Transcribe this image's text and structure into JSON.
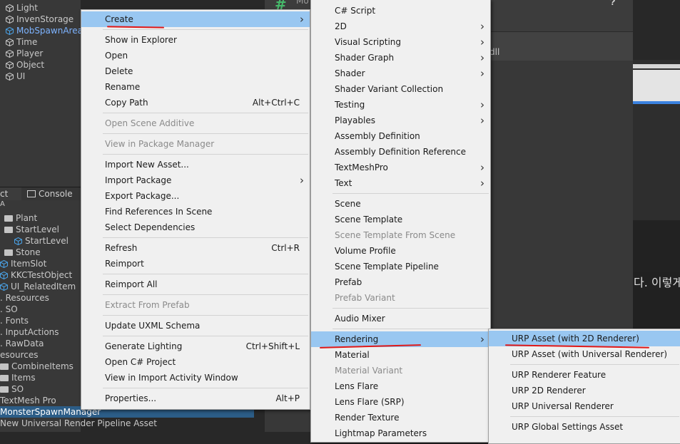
{
  "hierarchy": {
    "items": [
      "Light",
      "InvenStorage",
      "MobSpawnArea",
      "Time",
      "Player",
      "Object",
      "UI"
    ],
    "selected_index": 2
  },
  "tabs": {
    "project": "ct",
    "console": "Console"
  },
  "project": {
    "search": "A",
    "items": [
      "Plant",
      "StartLevel",
      "StartLevel",
      "Stone",
      "ItemSlot",
      "KKCTestObject",
      "UI_RelatedItem",
      ". Resources",
      ". SO",
      ". Fonts",
      ". InputActions",
      ". RawData",
      "esources",
      "CombineItems",
      "Items",
      "SO",
      "TextMesh Pro",
      "MonsterSpawnManager",
      "New Universal Render Pipeline Asset"
    ],
    "selected_index": 17
  },
  "inspector": {
    "hash_icon": "#",
    "header_text": "Mo",
    "field_tail": "dll",
    "korean_text": "다. 이렇게"
  },
  "context_menu": {
    "items": [
      {
        "label": "Create",
        "arrow": true,
        "highlight": true
      },
      {
        "sep": true
      },
      {
        "label": "Show in Explorer"
      },
      {
        "label": "Open"
      },
      {
        "label": "Delete"
      },
      {
        "label": "Rename"
      },
      {
        "label": "Copy Path",
        "shortcut": "Alt+Ctrl+C"
      },
      {
        "sep": true
      },
      {
        "label": "Open Scene Additive",
        "disabled": true
      },
      {
        "sep": true
      },
      {
        "label": "View in Package Manager",
        "disabled": true
      },
      {
        "sep": true
      },
      {
        "label": "Import New Asset..."
      },
      {
        "label": "Import Package",
        "arrow": true
      },
      {
        "label": "Export Package..."
      },
      {
        "label": "Find References In Scene"
      },
      {
        "label": "Select Dependencies"
      },
      {
        "sep": true
      },
      {
        "label": "Refresh",
        "shortcut": "Ctrl+R"
      },
      {
        "label": "Reimport"
      },
      {
        "sep": true
      },
      {
        "label": "Reimport All"
      },
      {
        "sep": true
      },
      {
        "label": "Extract From Prefab",
        "disabled": true
      },
      {
        "sep": true
      },
      {
        "label": "Update UXML Schema"
      },
      {
        "sep": true
      },
      {
        "label": "Generate Lighting",
        "shortcut": "Ctrl+Shift+L"
      },
      {
        "label": "Open C# Project"
      },
      {
        "label": "View in Import Activity Window"
      },
      {
        "sep": true
      },
      {
        "label": "Properties...",
        "shortcut": "Alt+P"
      }
    ]
  },
  "create_menu": {
    "items": [
      {
        "label": "C# Script"
      },
      {
        "label": "2D",
        "arrow": true
      },
      {
        "label": "Visual Scripting",
        "arrow": true
      },
      {
        "label": "Shader Graph",
        "arrow": true
      },
      {
        "label": "Shader",
        "arrow": true
      },
      {
        "label": "Shader Variant Collection"
      },
      {
        "label": "Testing",
        "arrow": true
      },
      {
        "label": "Playables",
        "arrow": true
      },
      {
        "label": "Assembly Definition"
      },
      {
        "label": "Assembly Definition Reference"
      },
      {
        "label": "TextMeshPro",
        "arrow": true
      },
      {
        "label": "Text",
        "arrow": true
      },
      {
        "sep": true
      },
      {
        "label": "Scene"
      },
      {
        "label": "Scene Template"
      },
      {
        "label": "Scene Template From Scene",
        "disabled": true
      },
      {
        "label": "Volume Profile"
      },
      {
        "label": "Scene Template Pipeline"
      },
      {
        "label": "Prefab"
      },
      {
        "label": "Prefab Variant",
        "disabled": true
      },
      {
        "sep": true
      },
      {
        "label": "Audio Mixer"
      },
      {
        "sep": true
      },
      {
        "label": "Rendering",
        "arrow": true,
        "highlight": true
      },
      {
        "label": "Material"
      },
      {
        "label": "Material Variant",
        "disabled": true
      },
      {
        "label": "Lens Flare"
      },
      {
        "label": "Lens Flare (SRP)"
      },
      {
        "label": "Render Texture"
      },
      {
        "label": "Lightmap Parameters"
      }
    ]
  },
  "rendering_menu": {
    "items": [
      {
        "label": "URP Asset (with 2D Renderer)",
        "highlight": true
      },
      {
        "label": "URP Asset (with Universal Renderer)"
      },
      {
        "sep": true
      },
      {
        "label": "URP Renderer Feature"
      },
      {
        "label": "URP 2D Renderer"
      },
      {
        "label": "URP Universal Renderer"
      },
      {
        "sep": true
      },
      {
        "label": "URP Global Settings Asset"
      }
    ]
  },
  "colors": {
    "highlight": "#99c7f1",
    "selection": "#2c5d87",
    "annotation": "#e01818",
    "cube": "#4aa3e8"
  }
}
